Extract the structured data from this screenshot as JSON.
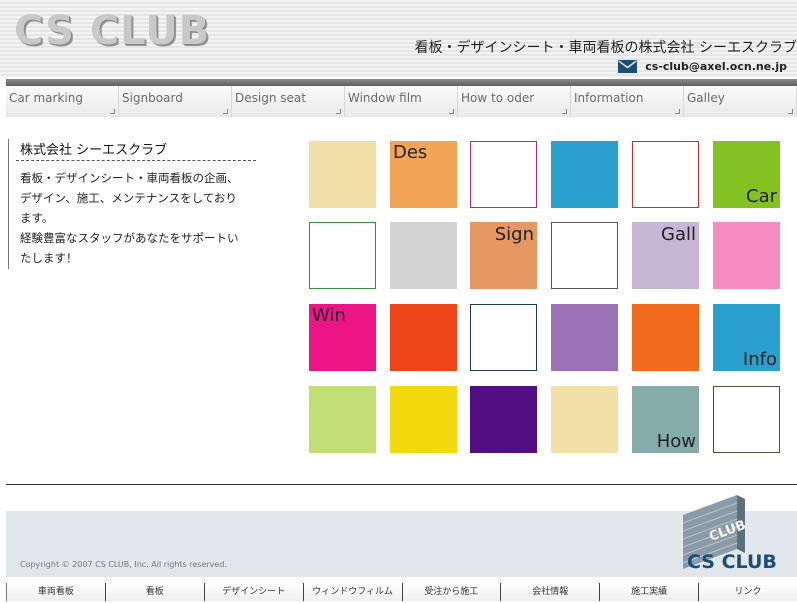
{
  "header": {
    "logo": "CS CLUB",
    "tagline": "看板・デザインシート・車両看板の株式会社 シーエスクラブ",
    "email": "cs-club@axel.ocn.ne.jp",
    "email_icon": "envelope-icon"
  },
  "nav": {
    "items": [
      {
        "label": "Car marking"
      },
      {
        "label": "Signboard"
      },
      {
        "label": "Design seat"
      },
      {
        "label": "Window film"
      },
      {
        "label": "How to oder"
      },
      {
        "label": "Information"
      },
      {
        "label": "Galley"
      }
    ]
  },
  "intro": {
    "title": "株式会社 シーエスクラブ",
    "text_lines": [
      "看板・デザインシート・車両看板の企画、",
      "デザイン、施工、メンテナンスをしており",
      "ます。",
      "経験豊富なスタッフがあなたをサポートい",
      "たします！"
    ]
  },
  "tiles": [
    {
      "color": "#f3e0a8",
      "border": "",
      "label": ""
    },
    {
      "color": "#f2a555",
      "border": "",
      "label": "Des"
    },
    {
      "color": "#ffffff",
      "border": "#b0306a",
      "label": ""
    },
    {
      "color": "#29a0cd",
      "border": "",
      "label": ""
    },
    {
      "color": "#ffffff",
      "border": "#c0302e",
      "label": ""
    },
    {
      "color": "#84c224",
      "border": "",
      "label": "Car"
    },
    {
      "color": "#ffffff",
      "border": "#3a8a44",
      "label": ""
    },
    {
      "color": "#d3d3d3",
      "border": "",
      "label": ""
    },
    {
      "color": "#e59861",
      "border": "",
      "label": "Sign"
    },
    {
      "color": "#ffffff",
      "border": "#555555",
      "label": ""
    },
    {
      "color": "#c8b6d6",
      "border": "",
      "label": "Gall"
    },
    {
      "color": "#f58bc0",
      "border": "",
      "label": ""
    },
    {
      "color": "#ed1585",
      "border": "",
      "label": "Win"
    },
    {
      "color": "#ee4419",
      "border": "",
      "label": ""
    },
    {
      "color": "#ffffff",
      "border": "#1f3a58",
      "label": ""
    },
    {
      "color": "#9b72b6",
      "border": "",
      "label": ""
    },
    {
      "color": "#f26a1b",
      "border": "",
      "label": ""
    },
    {
      "color": "#29a0cd",
      "border": "",
      "label": "Info"
    },
    {
      "color": "#c2df76",
      "border": "",
      "label": ""
    },
    {
      "color": "#f1d90d",
      "border": "",
      "label": ""
    },
    {
      "color": "#520f84",
      "border": "",
      "label": ""
    },
    {
      "color": "#f3e0a8",
      "border": "",
      "label": ""
    },
    {
      "color": "#86aca9",
      "border": "",
      "label": "How"
    },
    {
      "color": "#ffffff",
      "border": "#5a4a3a",
      "label": ""
    }
  ],
  "footer": {
    "copyright": "Copyright © 2007 CS CLUB, Inc. All rights reserved.",
    "logo": "CS CLUB",
    "logo_small": "CLUB",
    "nav": [
      {
        "label": "車両看板"
      },
      {
        "label": "看板"
      },
      {
        "label": "デザインシート"
      },
      {
        "label": "ウィンドウフィルム"
      },
      {
        "label": "受注から施工"
      },
      {
        "label": "会社情報"
      },
      {
        "label": "施工実績"
      },
      {
        "label": "リンク"
      }
    ]
  }
}
